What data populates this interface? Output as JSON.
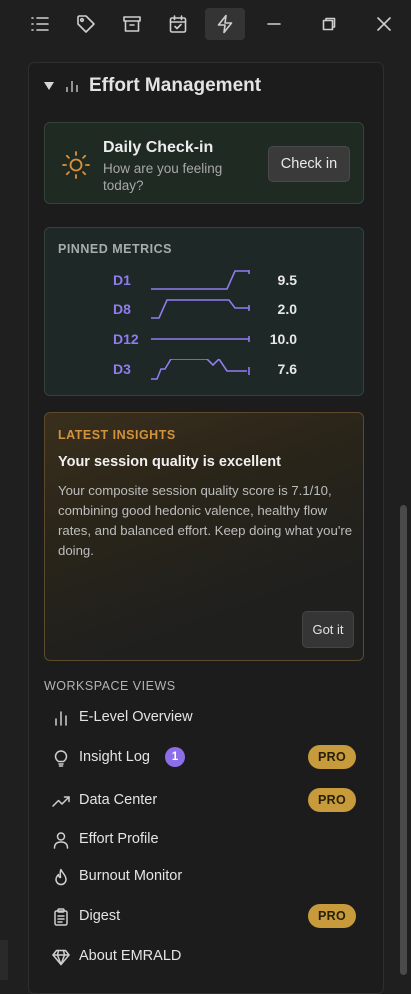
{
  "toolbar": {
    "icons": [
      "list-icon",
      "tag-icon",
      "archive-icon",
      "calendar-check-icon",
      "lightning-icon"
    ],
    "active": "lightning-icon",
    "window_controls": [
      "minimize-icon",
      "restore-icon",
      "close-icon"
    ]
  },
  "section": {
    "title": "Effort Management",
    "icon": "bar-chart-icon",
    "expanded": true
  },
  "checkin": {
    "title": "Daily Check-in",
    "subtitle": "How are you feeling today?",
    "button": "Check in",
    "icon": "sun-icon"
  },
  "pinned_metrics": {
    "label": "PINNED METRICS",
    "rows": [
      {
        "code": "D1",
        "value": "9.5"
      },
      {
        "code": "D8",
        "value": "2.0"
      },
      {
        "code": "D12",
        "value": "10.0"
      },
      {
        "code": "D3",
        "value": "7.6"
      }
    ]
  },
  "insights": {
    "label": "LATEST INSIGHTS",
    "headline": "Your session quality is excellent",
    "body": "Your composite session quality score is 7.1/10, combining good hedonic valence, healthy flow rates, and balanced effort. Keep doing what you're doing.",
    "button": "Got it"
  },
  "workspace": {
    "label": "WORKSPACE VIEWS",
    "items": [
      {
        "label": "E-Level Overview",
        "icon": "bar-chart-icon",
        "badge": "",
        "pro": ""
      },
      {
        "label": "Insight Log",
        "icon": "lightbulb-icon",
        "badge": "1",
        "pro": "PRO"
      },
      {
        "label": "Data Center",
        "icon": "trend-up-icon",
        "badge": "",
        "pro": "PRO"
      },
      {
        "label": "Effort Profile",
        "icon": "user-icon",
        "badge": "",
        "pro": ""
      },
      {
        "label": "Burnout Monitor",
        "icon": "flame-icon",
        "badge": "",
        "pro": ""
      },
      {
        "label": "Digest",
        "icon": "clipboard-icon",
        "badge": "",
        "pro": "PRO"
      },
      {
        "label": "About EMRALD",
        "icon": "diamond-icon",
        "badge": "",
        "pro": ""
      }
    ]
  },
  "colors": {
    "accent_purple": "#8f7cf0",
    "pro_gold": "#c79a3c",
    "insight_orange": "#d3923c",
    "sun_orange": "#e0923a"
  }
}
